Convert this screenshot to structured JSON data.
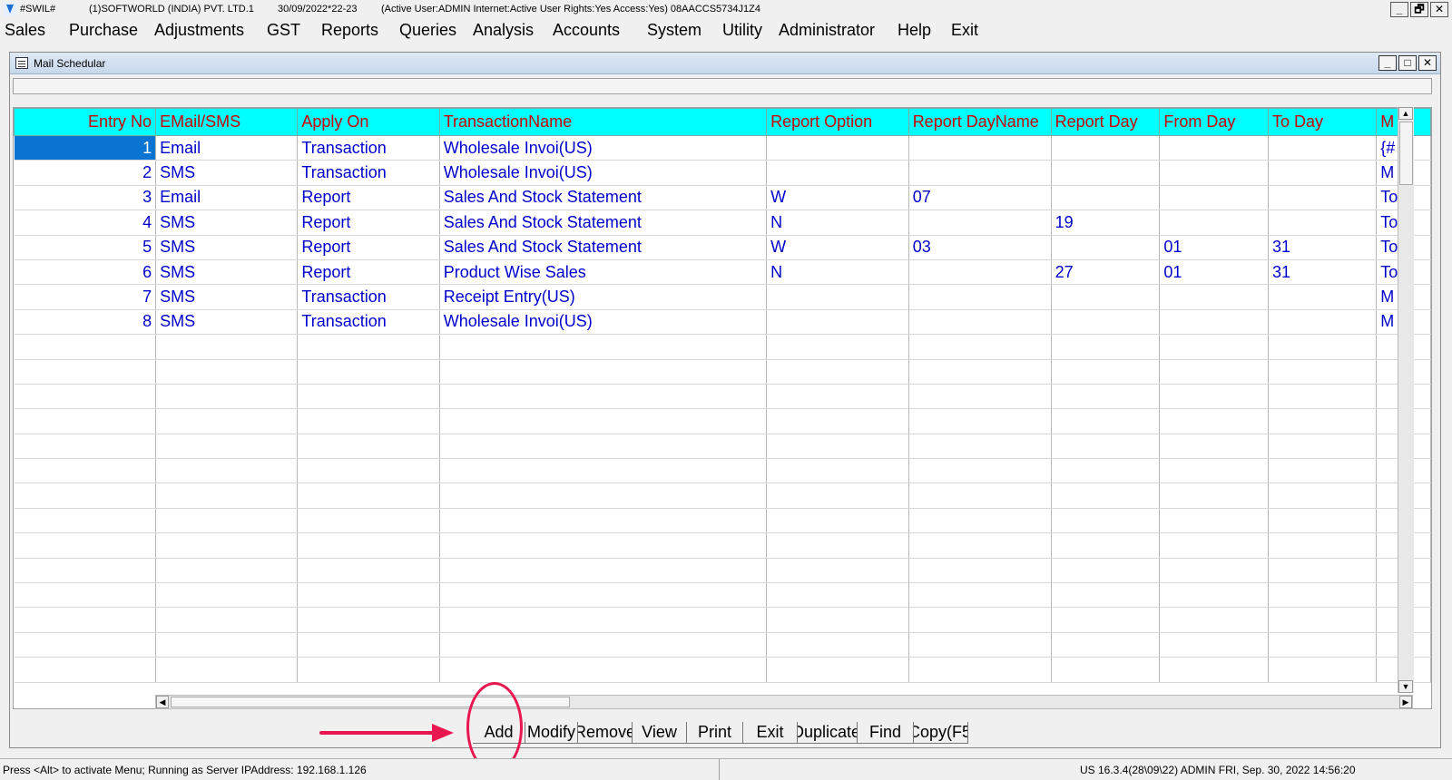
{
  "window": {
    "app_id": "#SWIL#",
    "company": "(1)SOFTWORLD (INDIA) PVT. LTD.1",
    "date_period": "30/09/2022*22-23",
    "session_info": "(Active User:ADMIN Internet:Active  User Rights:Yes Access:Yes) 08AACCS5734J1Z4",
    "buttons": [
      "_",
      "🗗",
      "✕"
    ]
  },
  "menu": [
    {
      "label": "Sales"
    },
    {
      "label": "Purchase"
    },
    {
      "label": "Adjustments"
    },
    {
      "label": "GST"
    },
    {
      "label": "Reports"
    },
    {
      "label": "Queries"
    },
    {
      "label": "Analysis"
    },
    {
      "label": "Accounts"
    },
    {
      "label": "System"
    },
    {
      "label": "Utility"
    },
    {
      "label": "Administrator"
    },
    {
      "label": "Help"
    },
    {
      "label": "Exit"
    }
  ],
  "child_window": {
    "title": "Mail Schedular",
    "buttons": [
      "_",
      "□",
      "✕"
    ]
  },
  "grid": {
    "headers": [
      "Entry No",
      "EMail/SMS",
      "Apply On",
      "TransactionName",
      "Report Option",
      "Report DayName",
      "Report Day",
      "From Day",
      "To Day",
      "M"
    ],
    "rows": [
      [
        "1",
        "Email",
        "Transaction",
        "Wholesale Invoi(US)",
        "",
        "",
        "",
        "",
        "",
        "{#"
      ],
      [
        "2",
        "SMS",
        "Transaction",
        "Wholesale Invoi(US)",
        "",
        "",
        "",
        "",
        "",
        "M"
      ],
      [
        "3",
        "Email",
        "Report",
        "Sales And Stock Statement",
        "W",
        "07",
        "",
        "",
        "",
        "To"
      ],
      [
        "4",
        "SMS",
        "Report",
        "Sales And Stock Statement",
        "N",
        "",
        "19",
        "",
        "",
        "To"
      ],
      [
        "5",
        "SMS",
        "Report",
        "Sales And Stock Statement",
        "W",
        "03",
        "",
        "01",
        "31",
        "To"
      ],
      [
        "6",
        "SMS",
        "Report",
        "Product Wise Sales",
        "N",
        "",
        "27",
        "01",
        "31",
        "To"
      ],
      [
        "7",
        "SMS",
        "Transaction",
        "Receipt Entry(US)",
        "",
        "",
        "",
        "",
        "",
        "M"
      ],
      [
        "8",
        "SMS",
        "Transaction",
        "Wholesale Invoi(US)",
        "",
        "",
        "",
        "",
        "",
        "M"
      ]
    ],
    "empty_rows": 14
  },
  "commands": [
    "Add",
    "Modify",
    "Remove",
    "View",
    "Print",
    "Exit",
    "Duplicate",
    "Find",
    "Copy(F5"
  ],
  "status": {
    "left": "Press <Alt> to activate Menu; Running as Server IPAddress: 192.168.1.126",
    "right": "US 16.3.4(28\\09\\22) ADMIN  FRI, Sep. 30, 2022  14:56:20"
  },
  "colors": {
    "header_bg": "#00ffff",
    "header_text": "#cc0000",
    "cell_text": "#0000cc",
    "selection": "#0a74d2",
    "annotation": "#e8174f"
  }
}
